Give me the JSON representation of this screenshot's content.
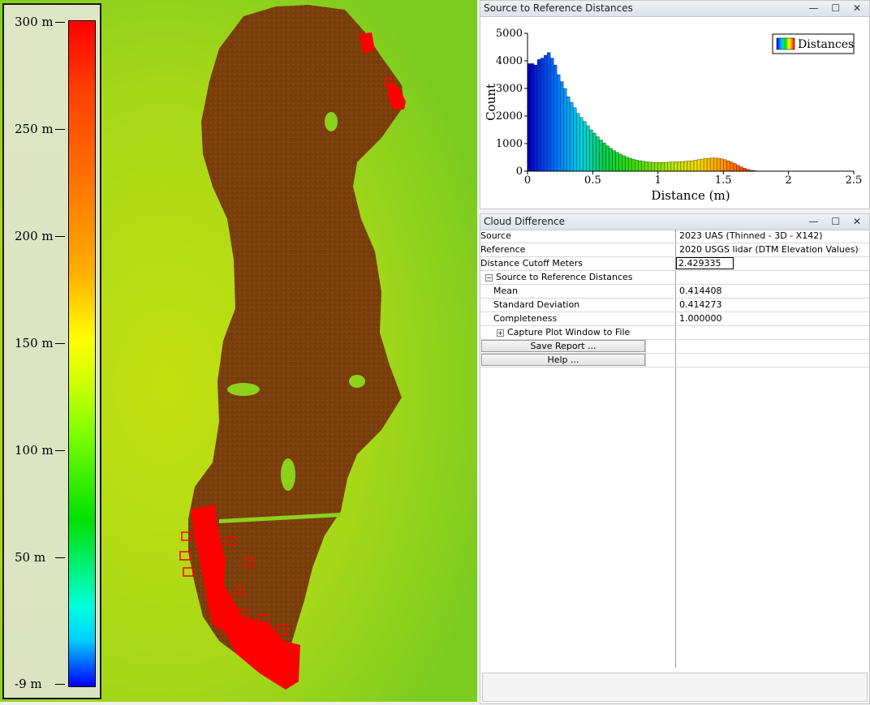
{
  "legend": {
    "ticks": [
      "300 m",
      "250 m",
      "200 m",
      "150 m",
      "100 m",
      "50 m",
      "-9 m"
    ]
  },
  "plot_window": {
    "title": "Source to Reference Distances",
    "controls": {
      "minimize": "—",
      "maximize": "☐",
      "close": "✕"
    }
  },
  "chart_data": {
    "type": "bar",
    "xlabel": "Distance (m)",
    "ylabel": "Count",
    "legend": "Distances",
    "legend_position": "top-right",
    "xlim": [
      0,
      2.5
    ],
    "ylim": [
      0,
      5000
    ],
    "xticks": [
      "0",
      "0.5",
      "1",
      "1.5",
      "2",
      "2.5"
    ],
    "yticks": [
      "0",
      "1000",
      "2000",
      "3000",
      "4000",
      "5000"
    ],
    "bin_width": 0.025,
    "values": [
      3900,
      3900,
      3850,
      4050,
      4100,
      4200,
      4300,
      4100,
      3850,
      3500,
      3250,
      3000,
      2700,
      2500,
      2300,
      2100,
      1950,
      1800,
      1650,
      1500,
      1380,
      1250,
      1130,
      1020,
      920,
      830,
      750,
      680,
      620,
      560,
      510,
      470,
      430,
      400,
      380,
      360,
      340,
      330,
      320,
      320,
      320,
      320,
      320,
      330,
      330,
      340,
      340,
      350,
      360,
      370,
      380,
      400,
      420,
      440,
      460,
      470,
      480,
      480,
      470,
      450,
      420,
      380,
      330,
      280,
      220,
      160,
      110,
      70,
      40,
      20,
      10,
      5
    ]
  },
  "diff_window": {
    "title": "Cloud Difference",
    "controls": {
      "minimize": "—",
      "maximize": "☐",
      "close": "✕"
    },
    "source_label": "Source",
    "source_value": "2023 UAS (Thinned - 3D - X142)",
    "reference_label": "Reference",
    "reference_value": "2020 USGS lidar  (DTM Elevation Values)",
    "cutoff_label": "Distance Cutoff Meters",
    "cutoff_value": "2.429335",
    "group_label": "Source to Reference Distances",
    "mean_label": "Mean",
    "mean_value": "0.414408",
    "std_label": "Standard Deviation",
    "std_value": "0.414273",
    "completeness_label": "Completeness",
    "completeness_value": "1.000000",
    "capture_label": "Capture Plot Window to File",
    "save_button": "Save Report ...",
    "help_button": "Help ..."
  },
  "colors": {
    "point_cloud": "#7a3f0b",
    "high_difference": "#ff0000",
    "terrain_green": "#7ec81a"
  }
}
